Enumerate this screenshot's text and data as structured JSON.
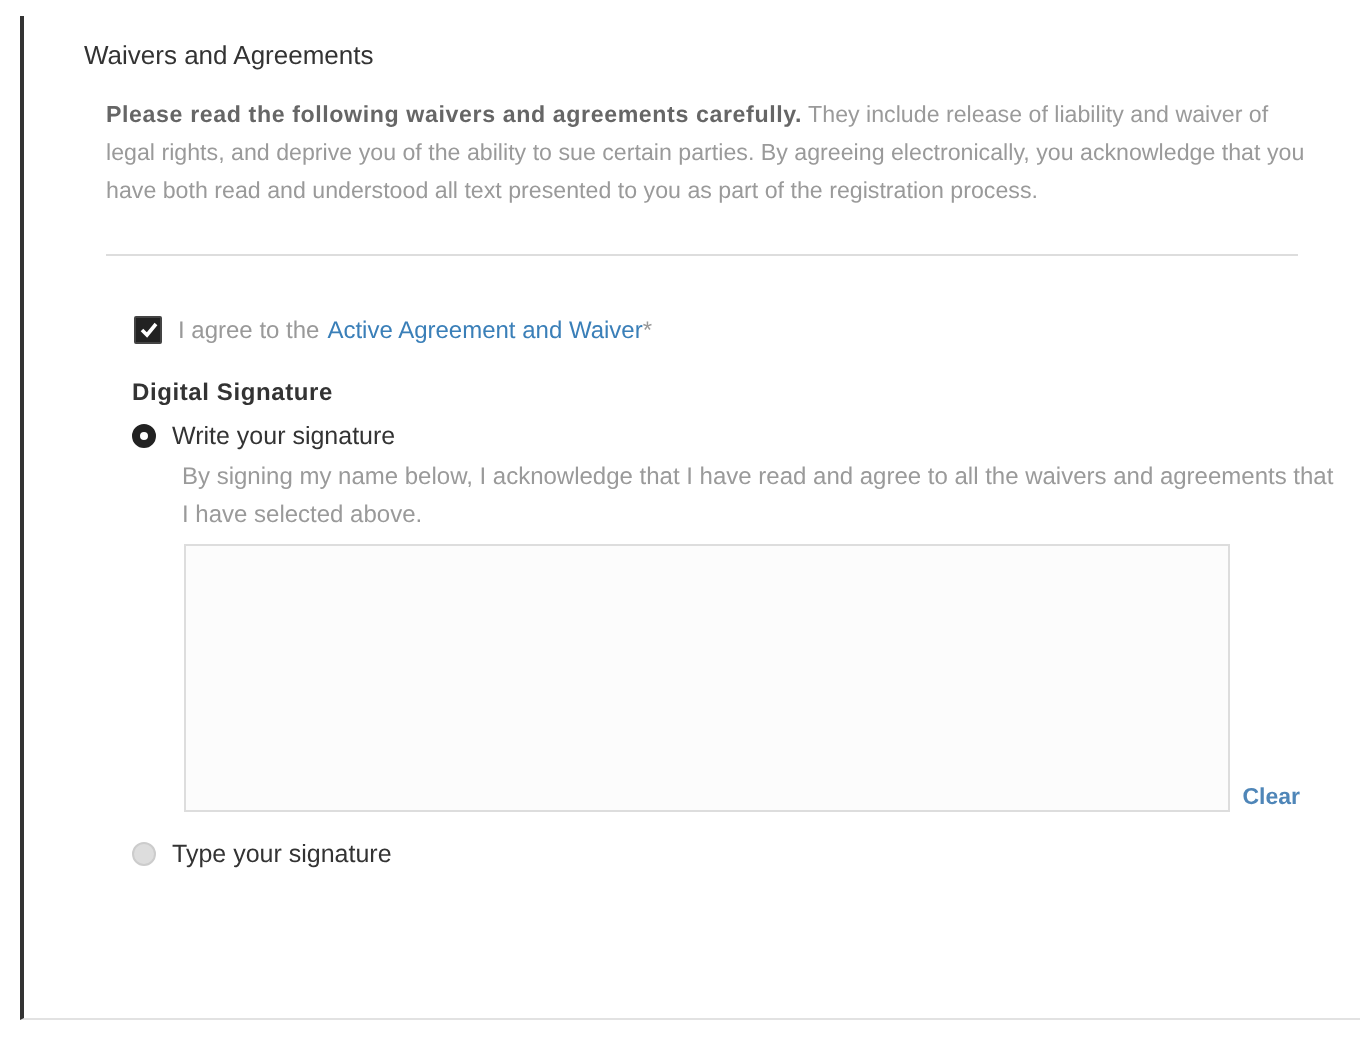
{
  "section": {
    "title": "Waivers and Agreements"
  },
  "intro": "**Please read the following waivers and agreements carefully.** They include release of liability and waiver of legal rights, and deprive you of the ability to sue certain parties. By agreeing electronically, you acknowledge that you have both read and understood all text presented to you as part of the registration process.",
  "agreement": {
    "checked": true,
    "label": "I agree to the",
    "link": "Active Agreement and Waiver",
    "required_mark": "*"
  },
  "signature": {
    "heading": "Digital Signature",
    "options": [
      {
        "label": "Write your signature",
        "selected": true,
        "description": "By signing my name below, I acknowledge that I have read and agree to all the waivers and agreements that I have selected above.",
        "clear": "Clear"
      },
      {
        "label": "Type your signature",
        "selected": false
      }
    ]
  }
}
